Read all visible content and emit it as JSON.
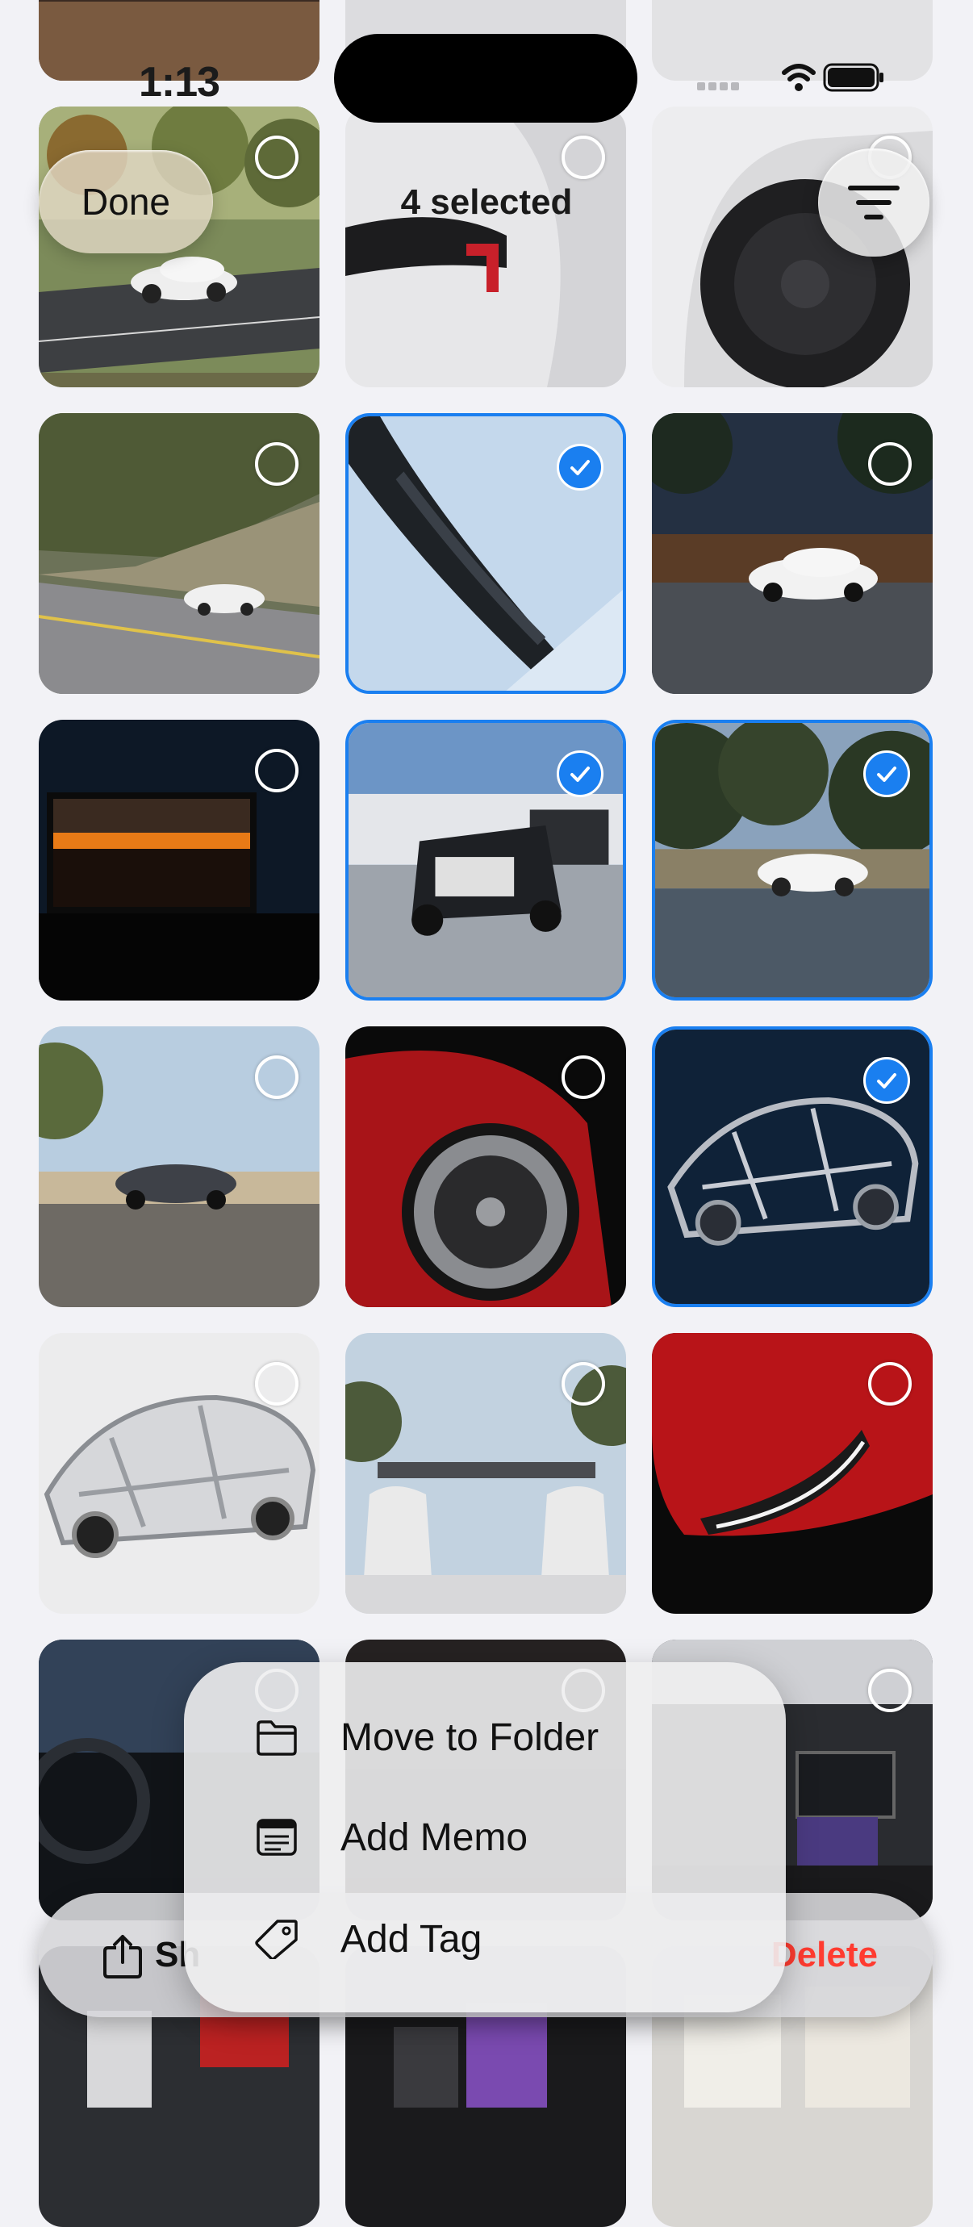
{
  "status_bar": {
    "time": "1:13"
  },
  "header": {
    "done_label": "Done",
    "selection_title": "4 selected",
    "sort_icon": "filter-lines-icon"
  },
  "photos": [
    {
      "id": "r0c0",
      "selected": false,
      "hint": "scenic-road-car"
    },
    {
      "id": "r0c1",
      "selected": false,
      "hint": "taillight-closeup"
    },
    {
      "id": "r0c2",
      "selected": false,
      "hint": "wheel-closeup"
    },
    {
      "id": "r1c0",
      "selected": false,
      "hint": "mountain-road-car"
    },
    {
      "id": "r1c1",
      "selected": true,
      "hint": "white-panel-detail"
    },
    {
      "id": "r1c2",
      "selected": false,
      "hint": "night-patio-car"
    },
    {
      "id": "r2c0",
      "selected": false,
      "hint": "sunset-screen"
    },
    {
      "id": "r2c1",
      "selected": true,
      "hint": "open-trunk-car"
    },
    {
      "id": "r2c2",
      "selected": true,
      "hint": "forest-road-car"
    },
    {
      "id": "r3c0",
      "selected": false,
      "hint": "beach-car"
    },
    {
      "id": "r3c1",
      "selected": false,
      "hint": "red-wheel"
    },
    {
      "id": "r3c2",
      "selected": true,
      "hint": "chassis-dark"
    },
    {
      "id": "r4c0",
      "selected": false,
      "hint": "chassis-light"
    },
    {
      "id": "r4c1",
      "selected": false,
      "hint": "interior-seats-sky"
    },
    {
      "id": "r4c2",
      "selected": false,
      "hint": "red-headlight"
    },
    {
      "id": "r5c0",
      "selected": false,
      "hint": "dark-interior"
    },
    {
      "id": "r5c1",
      "selected": false,
      "hint": "dark-interior"
    },
    {
      "id": "r5c2",
      "selected": false,
      "hint": "dashboard"
    }
  ],
  "bottom_bar": {
    "share_label": "Sh",
    "share_icon": "share-icon",
    "delete_label": "Delete"
  },
  "menu": {
    "items": [
      {
        "label": "Move to Folder",
        "icon": "folder-icon"
      },
      {
        "label": "Add Memo",
        "icon": "memo-icon"
      },
      {
        "label": "Add Tag",
        "icon": "tag-icon"
      }
    ]
  },
  "colors": {
    "accent": "#1a7ff0",
    "destructive": "#ff3b30",
    "background": "#f2f2f6"
  }
}
